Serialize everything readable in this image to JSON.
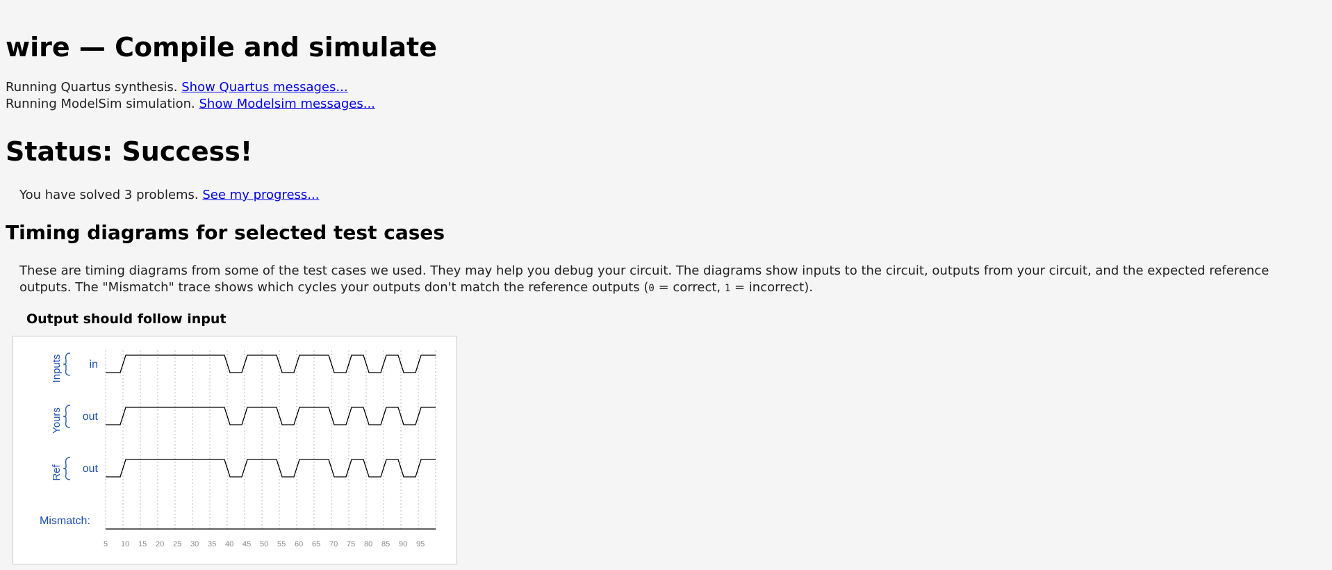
{
  "page_title": "wire — Compile and simulate",
  "run_quartus": {
    "text": "Running Quartus synthesis. ",
    "link": "Show Quartus messages..."
  },
  "run_modelsim": {
    "text": "Running ModelSim simulation. ",
    "link": "Show Modelsim messages..."
  },
  "status_heading": "Status: Success!",
  "progress": {
    "text": "You have solved 3 problems. ",
    "link": "See my progress..."
  },
  "timing_heading": "Timing diagrams for selected test cases",
  "description": {
    "part1": "These are timing diagrams from some of the test cases we used. They may help you debug your circuit. The diagrams show inputs to the circuit, outputs from your circuit, and the expected reference outputs. The \"Mismatch\" trace shows which cycles your outputs don't match the reference outputs (",
    "code0": "0",
    "part2": " = correct, ",
    "code1": "1",
    "part3": " = incorrect)."
  },
  "test_case": {
    "title": "Output should follow input",
    "groups": [
      {
        "label": "Inputs",
        "signals": [
          "in"
        ]
      },
      {
        "label": "Yours",
        "signals": [
          "out"
        ]
      },
      {
        "label": "Ref",
        "signals": [
          "out"
        ]
      }
    ],
    "mismatch_label": "Mismatch:",
    "time_ticks": [
      "5",
      "10",
      "15",
      "20",
      "25",
      "30",
      "35",
      "40",
      "45",
      "50",
      "55",
      "60",
      "65",
      "70",
      "75",
      "80",
      "85",
      "90",
      "95"
    ],
    "waveform_values": [
      0,
      1,
      1,
      1,
      1,
      1,
      1,
      0,
      1,
      1,
      0,
      1,
      1,
      0,
      1,
      0,
      1,
      0,
      1
    ],
    "mismatch_values": [
      0,
      0,
      0,
      0,
      0,
      0,
      0,
      0,
      0,
      0,
      0,
      0,
      0,
      0,
      0,
      0,
      0,
      0,
      0
    ],
    "colors": {
      "label": "#1a4fb5",
      "trace": "#000000",
      "grid": "#bbbbbb",
      "tick": "#888888"
    }
  }
}
